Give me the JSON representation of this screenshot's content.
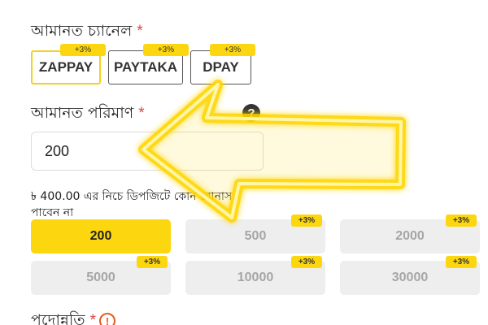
{
  "deposit_channel": {
    "label": "আমানত চ্যানেল",
    "required_mark": "*",
    "options": [
      {
        "label": "ZAPPAY",
        "bonus": "+3%",
        "selected": true
      },
      {
        "label": "PAYTAKA",
        "bonus": "+3%",
        "selected": false
      },
      {
        "label": "DPAY",
        "bonus": "+3%",
        "selected": false
      }
    ]
  },
  "deposit_amount": {
    "label": "আমানত পরিমাণ",
    "required_mark": "*",
    "help_icon": "question-icon",
    "value": "200",
    "note_line1": "৳ 400.00 এর নিচে ডিপজিটে কোন বোনাস",
    "note_line2": "পাবেন না"
  },
  "preset_amounts": [
    {
      "value": "200",
      "bonus": "",
      "selected": true
    },
    {
      "value": "500",
      "bonus": "+3%",
      "selected": false
    },
    {
      "value": "2000",
      "bonus": "+3%",
      "selected": false
    },
    {
      "value": "5000",
      "bonus": "+3%",
      "selected": false
    },
    {
      "value": "10000",
      "bonus": "+3%",
      "selected": false
    },
    {
      "value": "30000",
      "bonus": "+3%",
      "selected": false
    }
  ],
  "promotion": {
    "label": "পদোন্নতি",
    "required_mark": "*",
    "icon": "warning-icon"
  },
  "colors": {
    "accent_yellow": "#fcd60e",
    "required_red": "#e0443a",
    "arrow_glow": "#ffd400"
  }
}
